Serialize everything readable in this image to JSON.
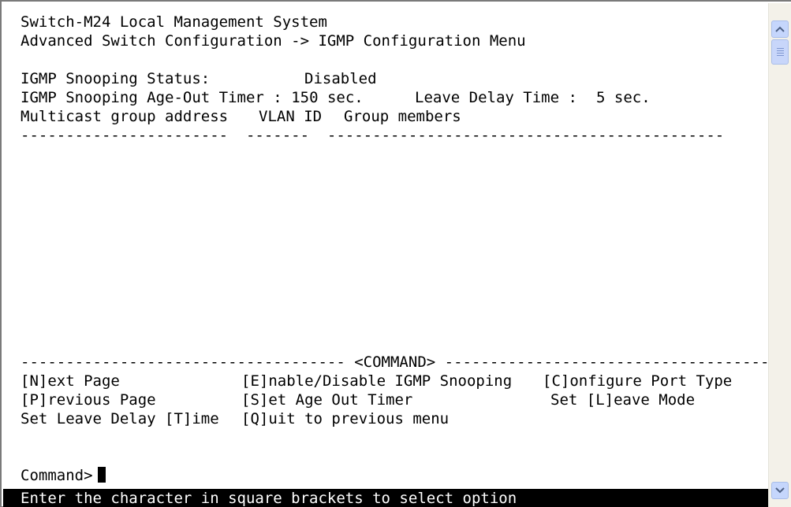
{
  "terminal": {
    "title_line": "Switch-M24 Local Management System",
    "breadcrumb_line": "Advanced Switch Configuration -> IGMP Configuration Menu",
    "status": {
      "snooping_status_label": "IGMP Snooping Status:",
      "snooping_status_value": "Disabled",
      "age_out_label": "IGMP Snooping Age-Out Timer :",
      "age_out_value": "150 sec.",
      "leave_delay_label": "Leave Delay Time :",
      "leave_delay_value": "5 sec."
    },
    "table": {
      "columns": [
        "Multicast group address",
        "VLAN ID",
        "Group members"
      ],
      "separator": "-----------------------  -------  --------------------------------------------",
      "rows": []
    },
    "command_divider": "------------------------------------ <COMMAND> -------------------------------------",
    "commands": {
      "next_page": "[N]ext Page",
      "toggle_snooping": "[E]nable/Disable IGMP Snooping",
      "configure_port_type": "[C]onfigure Port Type",
      "previous_page": "[P]revious Page",
      "set_age_out": "[S]et Age Out Timer",
      "set_leave_mode": "Set [L]eave Mode",
      "set_leave_delay": "Set Leave Delay [T]ime",
      "quit": "[Q]uit to previous menu"
    },
    "prompt": "Command>",
    "status_bar": "Enter the character in square brackets to select option"
  },
  "colors": {
    "text": "#000000",
    "background": "#ffffff",
    "status_bar_bg": "#000000",
    "status_bar_text": "#ffffff",
    "scrollbar_button": "#c5d6fc"
  },
  "icons": {
    "scroll_up": "chevron-up-icon",
    "scroll_down": "chevron-down-icon"
  }
}
